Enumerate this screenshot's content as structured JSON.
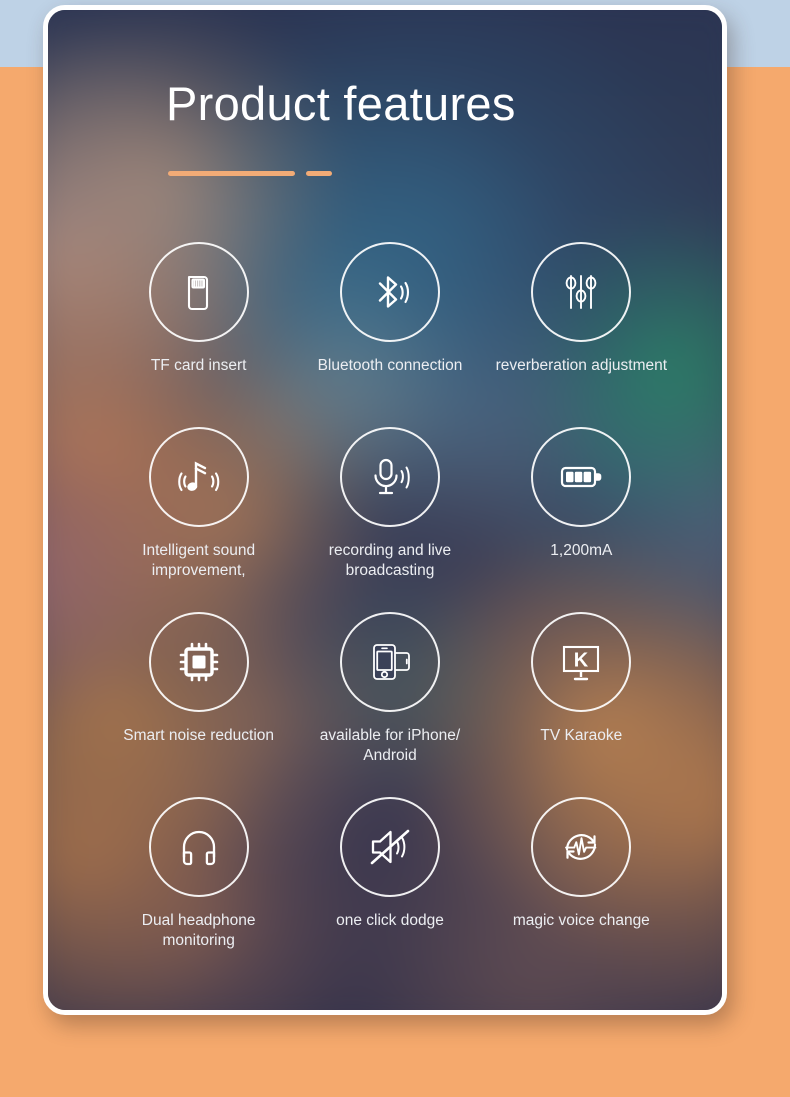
{
  "page": {
    "background_top_color": "#bed2e6",
    "background_color": "#f5a96d",
    "card_border_color": "#ffffff"
  },
  "header": {
    "title": "Product features",
    "accent_color": "#f2ab76"
  },
  "features": [
    {
      "icon": "tf-card-icon",
      "label": "TF card insert"
    },
    {
      "icon": "bluetooth-icon",
      "label": "Bluetooth connection"
    },
    {
      "icon": "equalizer-sliders-icon",
      "label": "reverberation adjustment"
    },
    {
      "icon": "music-note-waves-icon",
      "label": "Intelligent sound improvement,"
    },
    {
      "icon": "microphone-waves-icon",
      "label": "recording and live broadcasting"
    },
    {
      "icon": "battery-icon",
      "label": "1,200mA"
    },
    {
      "icon": "cpu-chip-icon",
      "label": "Smart noise reduction"
    },
    {
      "icon": "two-phones-icon",
      "label": "available for iPhone/ Android"
    },
    {
      "icon": "tv-karaoke-icon",
      "label": "TV Karaoke"
    },
    {
      "icon": "headphones-icon",
      "label": "Dual headphone monitoring"
    },
    {
      "icon": "muted-speaker-icon",
      "label": "one click dodge"
    },
    {
      "icon": "voice-change-icon",
      "label": "magic voice change"
    }
  ]
}
